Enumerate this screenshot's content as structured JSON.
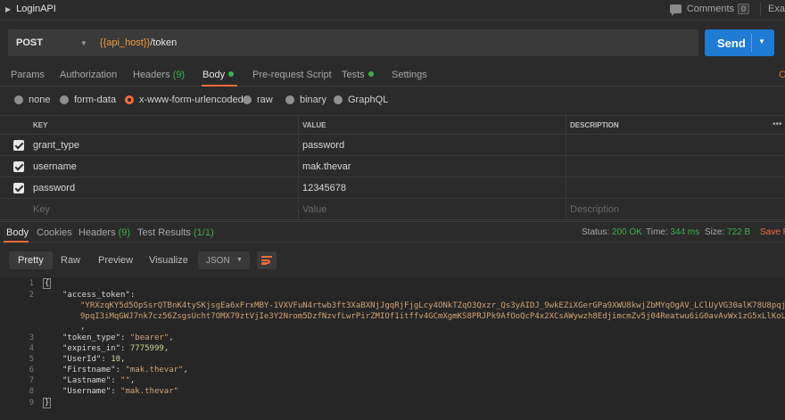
{
  "titlebar": {
    "title": "LoginAPI",
    "comments_label": "Comments",
    "comments_count": "0",
    "right_cut": "Exa"
  },
  "request": {
    "method": "POST",
    "url_var": "{{api_host}}",
    "url_path": "/token",
    "send_label": "Send"
  },
  "req_tabs": {
    "params": "Params",
    "authorization": "Authorization",
    "headers": "Headers",
    "headers_count": "(9)",
    "body": "Body",
    "prerequest": "Pre-request Script",
    "tests": "Tests",
    "settings": "Settings",
    "cut": "C"
  },
  "body_types": {
    "none": "none",
    "form_data": "form-data",
    "urlencoded": "x-www-form-urlencoded",
    "raw": "raw",
    "binary": "binary",
    "graphql": "GraphQL"
  },
  "params_table": {
    "headers": {
      "key": "KEY",
      "value": "VALUE",
      "description": "DESCRIPTION"
    },
    "rows": [
      {
        "key": "grant_type",
        "value": "password"
      },
      {
        "key": "username",
        "value": "mak.thevar"
      },
      {
        "key": "password",
        "value": "12345678"
      }
    ],
    "placeholder": {
      "key": "Key",
      "value": "Value",
      "description": "Description"
    }
  },
  "response_tabs": {
    "body": "Body",
    "cookies": "Cookies",
    "headers": "Headers",
    "headers_count": "(9)",
    "test_results": "Test Results",
    "test_count": "(1/1)",
    "status_label": "Status:",
    "status_value": "200 OK",
    "time_label": "Time:",
    "time_value": "344 ms",
    "size_label": "Size:",
    "size_value": "722 B",
    "save": "Save R"
  },
  "response_toolbar": {
    "pretty": "Pretty",
    "raw": "Raw",
    "preview": "Preview",
    "visualize": "Visualize",
    "format": "JSON"
  },
  "response_json": {
    "line_numbers": [
      "1",
      "2",
      "",
      "",
      "",
      "3",
      "4",
      "5",
      "6",
      "7",
      "8",
      "9"
    ],
    "access_token_key": "\"access_token\"",
    "access_token_line1": "\"YRXzqKY5d5OpSsrQTBnK4tySKjsgEa6xFrxMBY-1VXVFuN4rtwb3ft3XaBXNjJgqRjFjgLcy4ONkTZqO3Qxzr_Qs3yAIDJ_9wkEZiXGerGPa9XWU8kwjZbMYqOgAV_LClUyVG30alK78U8pqjvtP211lFVt",
    "access_token_line2": "9pqI3iMqGWJ7nk7cz56ZsgsUcht7OMX79ztVjIe3Y2Nrom5DzfNzvfLwrPirZMIOf1itffv4GCmXgmKS8PRJPk9AfOoQcP4x2XCsAWywzh8EdjimcmZv5j04Reatwu6iG0avAvWx1zG5xLlKoLUsfPA6SNbr",
    "token_type_key": "\"token_type\"",
    "token_type_val": "\"bearer\"",
    "expires_in_key": "\"expires_in\"",
    "expires_in_val": "7775999",
    "userid_key": "\"UserId\"",
    "userid_val": "10",
    "firstname_key": "\"Firstname\"",
    "firstname_val": "\"mak.thevar\"",
    "lastname_key": "\"Lastname\"",
    "lastname_val": "\"\"",
    "username_key": "\"Username\"",
    "username_val": "\"mak.thevar\""
  }
}
